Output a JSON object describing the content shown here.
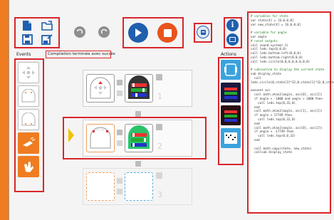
{
  "labels": {
    "events": "Events",
    "actions": "Actions",
    "status": "Compilation terminée avec succès"
  },
  "rows": [
    {
      "number": "1"
    },
    {
      "number": "2"
    },
    {
      "number": "3"
    }
  ],
  "code_lines": [
    "# variables for state",
    "var state[4] = [0,0,0,0]",
    "var new_state[4] = [0,0,0,0]",
    "",
    "# variable for angle",
    "var angle",
    "# reset outputs",
    "call sound.system(-1)",
    "call leds.top(0,0,0)",
    "call leds.bottom.left(0,0,0)",
    "call leds.bottom.right(0,0,0)",
    "call leds.circle(0,0,0,0,0,0,0,0)",
    "",
    "# subroutine to display the current state",
    "sub display_state",
    "  call",
    "leds.circle(0,state[3]*32,0,state[1]*32,0,state",
    "",
    "onevent acc",
    "  call math.atan2(angle, acc[0], acc[2])",
    "  if angle < -1000 and angle > 1000 then",
    "    call leds.top(0,32,0)",
    "  end",
    "  call math.atan2(angle, acc[1], acc[2])",
    "  if angle > 17749 then",
    "    call leds.top(0,32,0)",
    "  end",
    "  call math.atan2(angle, acc[0], acc[2])",
    "  if angle < -17749 then",
    "    call leds.top(0,0,32)",
    "  end",
    "",
    "  call math.copy(state, new_state)",
    "  callsub display_state"
  ],
  "icons": {
    "new": "new-file-icon",
    "open": "open-folder-icon",
    "save": "save-icon",
    "save_as": "save-as-icon",
    "undo": "undo-icon",
    "redo": "redo-icon",
    "run": "play-icon",
    "stop": "stop-icon",
    "robot": "robot-icon",
    "info": "info-icon",
    "screenshot": "camera-icon"
  },
  "colors": {
    "accent_orange": "#ef7c20",
    "highlight_red": "#d8262b",
    "play_blue": "#1f5fae",
    "stop_orange": "#e8541c"
  }
}
